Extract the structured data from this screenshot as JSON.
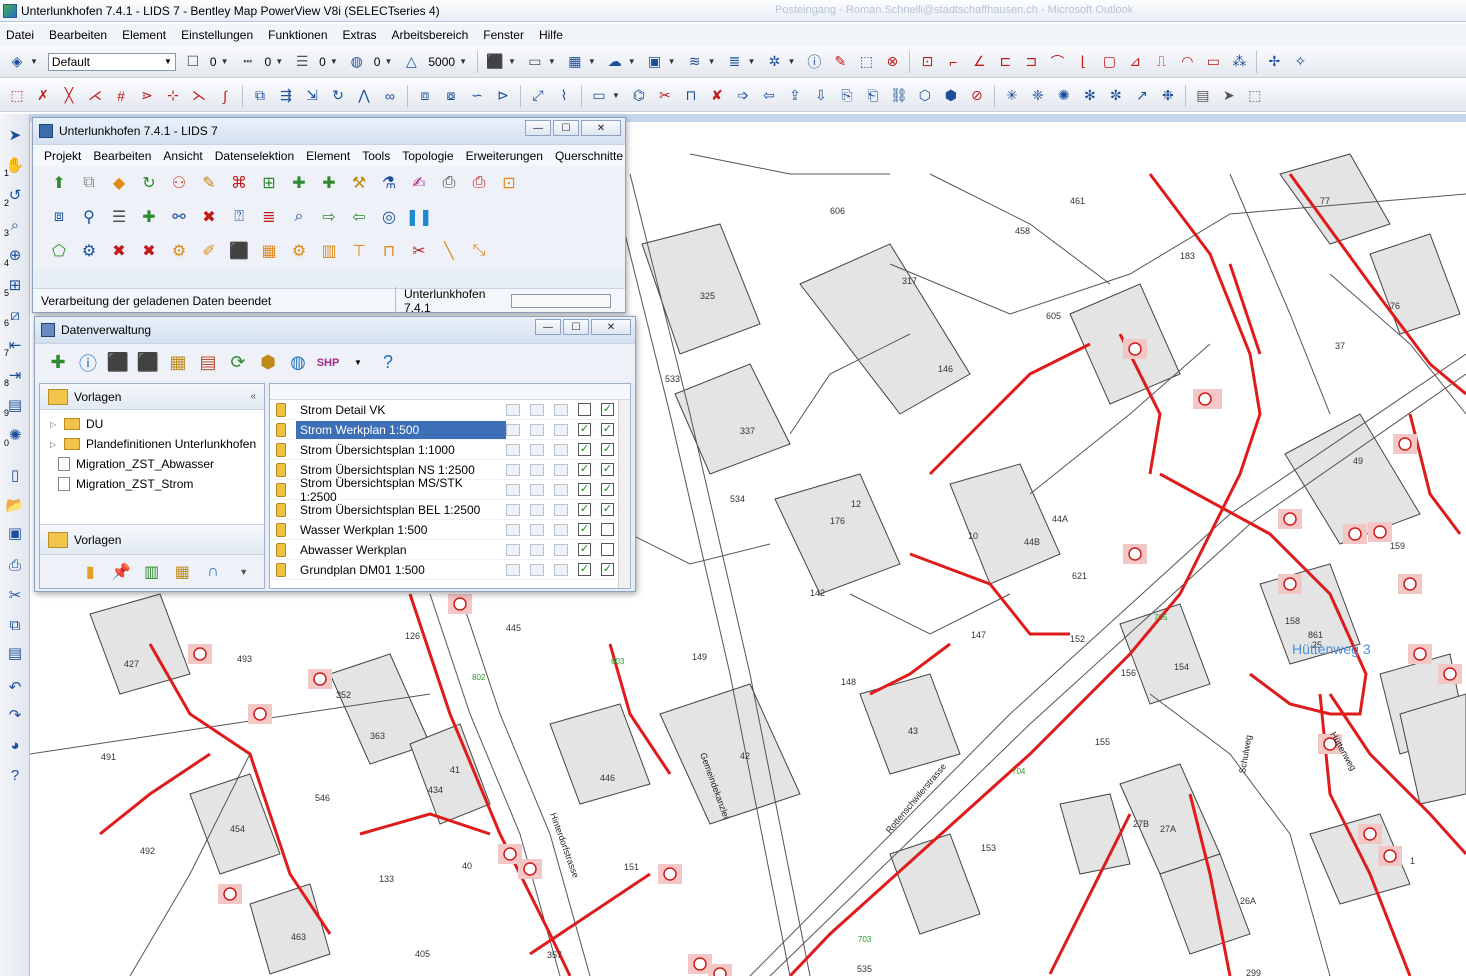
{
  "app": {
    "title": "Unterlunkhofen 7.4.1 - LIDS 7 - Bentley Map PowerView V8i (SELECTseries 4)",
    "ghost_text": "Posteingang - Roman.Schnelli@stadtschaffhausen.ch - Microsoft Outlook"
  },
  "menu": [
    "Datei",
    "Bearbeiten",
    "Element",
    "Einstellungen",
    "Funktionen",
    "Extras",
    "Arbeitsbereich",
    "Fenster",
    "Hilfe"
  ],
  "toolbar1": {
    "level": "Default",
    "color_value": "0",
    "style_value": "0",
    "weight_value": "0",
    "transparency_value": "0",
    "scale_value": "5000"
  },
  "leftbar": {
    "view_numbers": [
      "1",
      "2",
      "3",
      "4",
      "5",
      "6",
      "7",
      "8",
      "9",
      "0"
    ]
  },
  "lids_window": {
    "title": "Unterlunkhofen 7.4.1 - LIDS 7",
    "menu": [
      "Projekt",
      "Bearbeiten",
      "Ansicht",
      "Datenselektion",
      "Element",
      "Tools",
      "Topologie",
      "Erweiterungen",
      "Querschnitte"
    ],
    "status_message": "Verarbeitung der geladenen Daten beendet",
    "status_project": "Unterlunkhofen 7.4.1"
  },
  "dv_window": {
    "title": "Datenverwaltung",
    "shp_label": "SHP",
    "left_header": "Vorlagen",
    "left_footer": "Vorlagen",
    "tree": [
      {
        "label": "DU",
        "type": "folder"
      },
      {
        "label": "Plandefinitionen Unterlunkhofen",
        "type": "folder"
      },
      {
        "label": "Migration_ZST_Abwasser",
        "type": "doc"
      },
      {
        "label": "Migration_ZST_Strom",
        "type": "doc"
      }
    ],
    "templates": [
      {
        "name": "Strom Detail VK",
        "c1": false,
        "c2": true
      },
      {
        "name": "Strom Werkplan 1:500",
        "c1": true,
        "c2": true,
        "selected": true
      },
      {
        "name": "Strom Übersichtsplan 1:1000",
        "c1": true,
        "c2": true
      },
      {
        "name": "Strom Übersichtsplan NS 1:2500",
        "c1": true,
        "c2": true
      },
      {
        "name": "Strom Übersichtsplan MS/STK 1:2500",
        "c1": true,
        "c2": true
      },
      {
        "name": "Strom Übersichtsplan BEL 1:2500",
        "c1": true,
        "c2": true
      },
      {
        "name": "Wasser Werkplan 1:500",
        "c1": true,
        "c2": false
      },
      {
        "name": "Abwasser Werkplan",
        "c1": true,
        "c2": false
      },
      {
        "name": "Grundplan DM01 1:500",
        "c1": true,
        "c2": true
      }
    ]
  },
  "map": {
    "parcel_numbers": [
      "606",
      "461",
      "458",
      "77",
      "76",
      "183",
      "37",
      "325",
      "317",
      "146",
      "605",
      "533",
      "337",
      "534",
      "176",
      "12",
      "44A",
      "44B",
      "10",
      "621",
      "49",
      "159",
      "142",
      "147",
      "152",
      "156",
      "154",
      "158",
      "861",
      "149",
      "148",
      "155",
      "153",
      "427",
      "493",
      "352",
      "363",
      "126",
      "445",
      "491",
      "546",
      "41",
      "434",
      "446",
      "454",
      "492",
      "133",
      "40",
      "151",
      "463",
      "405",
      "357",
      "535",
      "299",
      "27A",
      "27B",
      "42",
      "43",
      "25",
      "26A",
      "1"
    ],
    "street_labels": [
      "Hinterdorfstrasse",
      "Rottenschwilerstrasse",
      "Hüttenweg",
      "Schulweg",
      "Gemeindekanzlei"
    ],
    "highlight_label": "Hüttenweg 3",
    "green_labels": [
      "703",
      "704",
      "705",
      "802",
      "603"
    ]
  }
}
